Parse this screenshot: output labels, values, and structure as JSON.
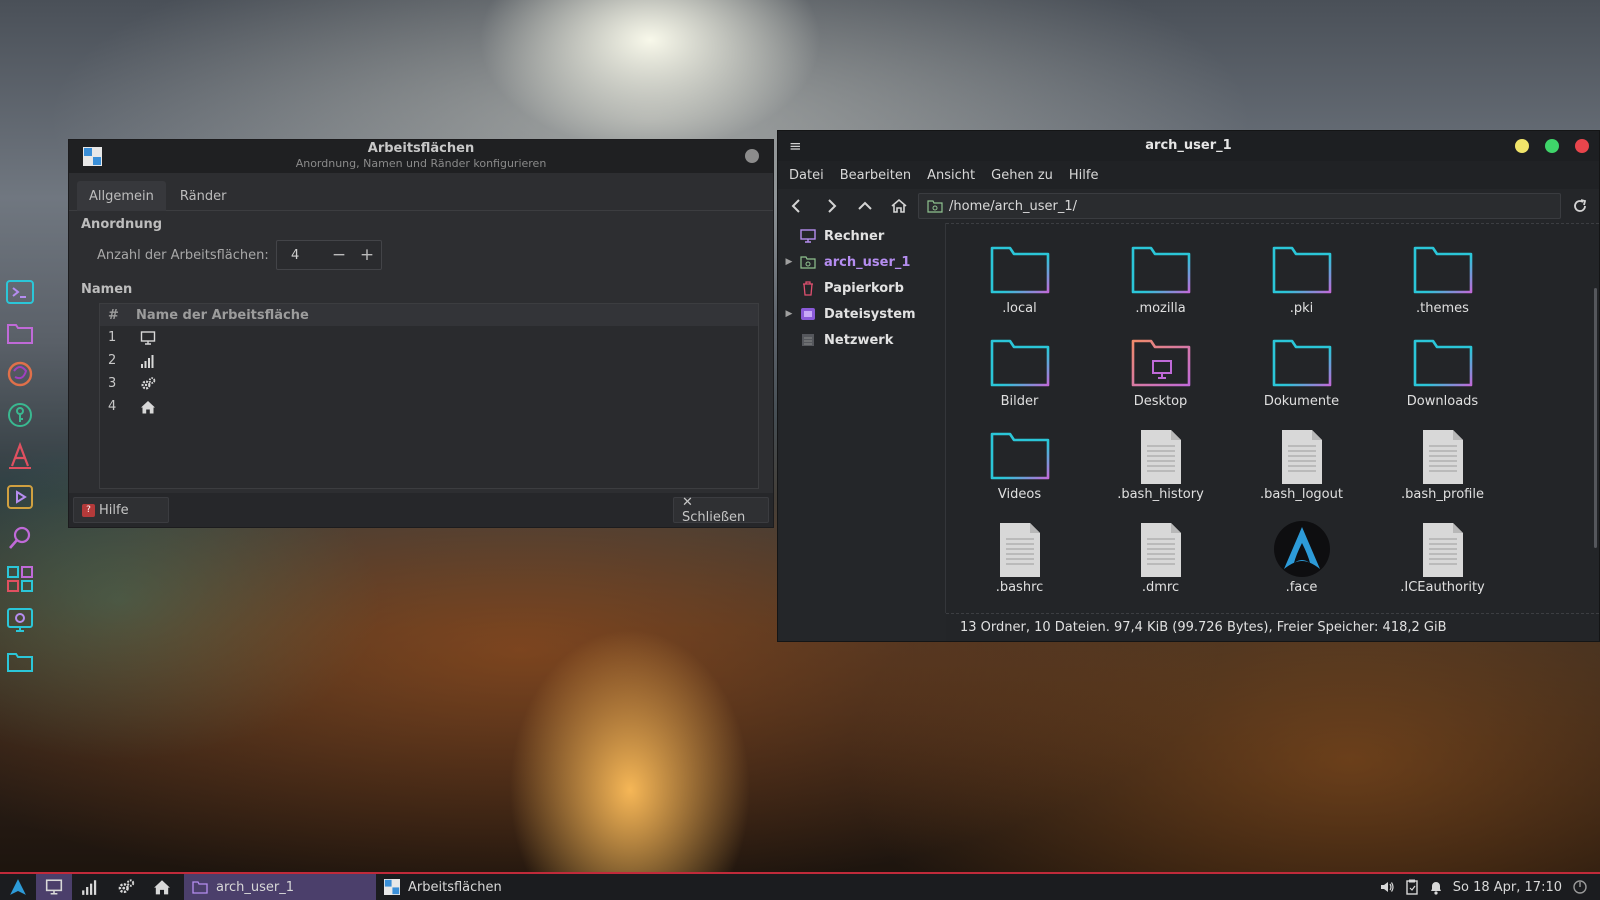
{
  "colors": {
    "accent_purple": "#b58df0",
    "folder_cyan": "#2bc6d8",
    "folder_pink": "#c06ad8",
    "taskbar_red": "#c02a3a",
    "dot_yellow": "#f0e46a",
    "dot_green": "#3fd46a",
    "dot_red": "#e8454c"
  },
  "dock": [
    {
      "name": "terminal-icon"
    },
    {
      "name": "folder-icon"
    },
    {
      "name": "firefox-icon"
    },
    {
      "name": "keepass-icon"
    },
    {
      "name": "font-icon"
    },
    {
      "name": "media-player-icon"
    },
    {
      "name": "search-icon"
    },
    {
      "name": "settings-manager-icon"
    },
    {
      "name": "screenshot-icon"
    },
    {
      "name": "files-icon"
    }
  ],
  "workspace_dialog": {
    "title": "Arbeitsflächen",
    "subtitle": "Anordnung, Namen und Ränder konfigurieren",
    "tabs": [
      "Allgemein",
      "Ränder"
    ],
    "section_layout": "Anordnung",
    "count_label": "Anzahl der Arbeitsflächen:",
    "count_value": "4",
    "minus": "−",
    "plus": "+",
    "section_names": "Namen",
    "table_headers": {
      "num": "#",
      "name": "Name der Arbeitsfläche"
    },
    "rows": [
      {
        "num": "1",
        "icon": "monitor-icon"
      },
      {
        "num": "2",
        "icon": "signal-bars-icon"
      },
      {
        "num": "3",
        "icon": "gears-icon"
      },
      {
        "num": "4",
        "icon": "home-icon"
      }
    ],
    "help_label": "Hilfe",
    "close_label": "✕ Schließen"
  },
  "file_manager": {
    "title": "arch_user_1",
    "menu": [
      "Datei",
      "Bearbeiten",
      "Ansicht",
      "Gehen zu",
      "Hilfe"
    ],
    "path": "/home/arch_user_1/",
    "sidebar": [
      {
        "label": "Rechner",
        "icon": "computer-icon",
        "arrow": ""
      },
      {
        "label": "arch_user_1",
        "icon": "home-folder-icon",
        "arrow": "▶"
      },
      {
        "label": "Papierkorb",
        "icon": "trash-icon",
        "arrow": ""
      },
      {
        "label": "Dateisystem",
        "icon": "drive-icon",
        "arrow": "▶"
      },
      {
        "label": "Netzwerk",
        "icon": "network-icon",
        "arrow": ""
      }
    ],
    "files": [
      {
        "label": ".local",
        "kind": "folder"
      },
      {
        "label": ".mozilla",
        "kind": "folder"
      },
      {
        "label": ".pki",
        "kind": "folder"
      },
      {
        "label": ".themes",
        "kind": "folder"
      },
      {
        "label": "Bilder",
        "kind": "folder"
      },
      {
        "label": "Desktop",
        "kind": "desktop"
      },
      {
        "label": "Dokumente",
        "kind": "folder"
      },
      {
        "label": "Downloads",
        "kind": "folder"
      },
      {
        "label": "Videos",
        "kind": "folder"
      },
      {
        "label": ".bash_history",
        "kind": "file"
      },
      {
        "label": ".bash_logout",
        "kind": "file"
      },
      {
        "label": ".bash_profile",
        "kind": "file"
      },
      {
        "label": ".bashrc",
        "kind": "file"
      },
      {
        "label": ".dmrc",
        "kind": "file"
      },
      {
        "label": ".face",
        "kind": "face"
      },
      {
        "label": ".ICEauthority",
        "kind": "file"
      }
    ],
    "status": "13 Ordner, 10 Dateien. 97,4 KiB (99.726 Bytes), Freier Speicher: 418,2 GiB"
  },
  "taskbar": {
    "launchers": [
      "arch-logo-icon",
      "monitor-icon",
      "signal-bars-icon",
      "gears-icon",
      "home-icon"
    ],
    "tasks": [
      {
        "label": "arch_user_1",
        "active": true
      },
      {
        "label": "Arbeitsflächen",
        "active": false
      }
    ],
    "clock": "So 18 Apr, 17:10"
  }
}
